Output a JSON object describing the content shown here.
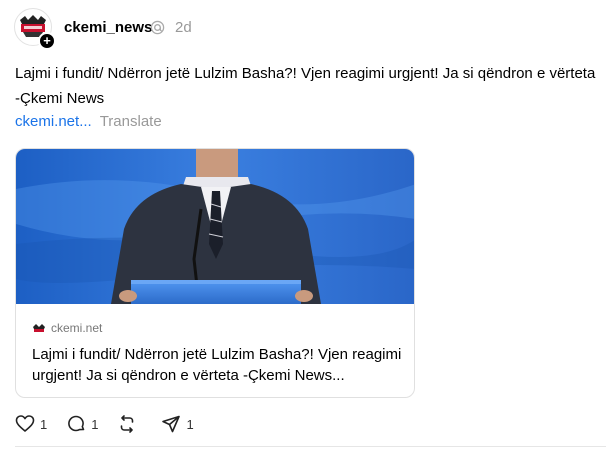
{
  "post": {
    "username": "ckemi_news",
    "time": "2d",
    "text": "Lajmi i fundit/ Ndërron jetë Lulzim Basha?! Vjen reagimi urgjent! Ja si qëndron e vërteta -Çkemi News",
    "link_text": "ckemi.net...",
    "translate_label": "Translate",
    "follow_badge": "+"
  },
  "card": {
    "domain": "ckemi.net",
    "title": "Lajmi i fundit/ Ndërron jetë Lulzim Basha?! Vjen reagimi urgjent! Ja si qëndron e vërteta -Çkemi News..."
  },
  "actions": {
    "like_count": "1",
    "reply_count": "1",
    "repost_count": "",
    "share_count": "1"
  },
  "icons": {
    "avatar": "ckemi-logo",
    "verify": "threads-activity-icon",
    "like": "heart-icon",
    "reply": "comment-icon",
    "repost": "repost-icon",
    "share": "send-icon"
  },
  "colors": {
    "link": "#1a73e8",
    "muted": "#999999",
    "image_bg": "#2c6bc9"
  }
}
